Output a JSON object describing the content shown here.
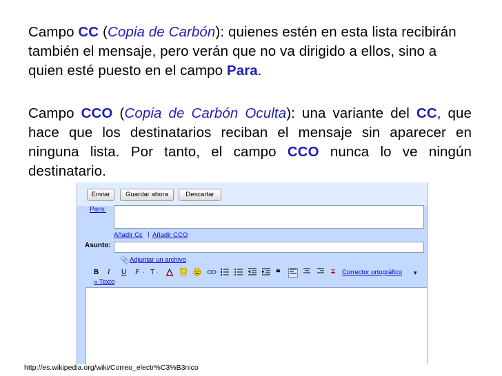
{
  "slide": {
    "p1": {
      "t1": "Campo ",
      "k1": "CC",
      "t2": " (",
      "i1": "Copia de Carbón",
      "t3": "): quienes estén en esta lista recibirán también el mensaje, pero verán que no va dirigido a ellos, sino a quien esté puesto en el campo ",
      "k2": "Para",
      "t4": "."
    },
    "p2": {
      "t1": "Campo ",
      "k1": "CCO",
      "t2": " (",
      "i1": "Copia de Carbón Oculta",
      "t3": "): una variante del ",
      "k2": "CC",
      "t4": ", que hace que los destinatarios reciban el mensaje sin aparecer en ninguna lista. Por tanto, el campo ",
      "k3": "CCO",
      "t5": " nunca lo ve ningún destinatario."
    },
    "source_url": "http://es.wikipedia.org/wiki/Correo_electr%C3%B3nico"
  },
  "compose": {
    "buttons": {
      "send": "Enviar",
      "save": "Guardar ahora",
      "discard": "Descartar"
    },
    "to_label": "Para:",
    "add_cc": "Añadir Cc",
    "separator": "|",
    "add_bcc": "Añadir CCO",
    "subject_label": "Asunto:",
    "attach": "Adjuntar un archivo",
    "format": {
      "bold": "B",
      "italic": "I",
      "underline": "U",
      "font": "F",
      "size": "T",
      "spellcheck": "Corrector ortográfico",
      "dropdown": "▾"
    },
    "plain_text": "« Texto"
  },
  "colors": {
    "keyword": "#1f1fb4",
    "compose_bg": "#c3d9ff",
    "toolbar_bg": "#e0ecff",
    "link": "#0000cc"
  }
}
